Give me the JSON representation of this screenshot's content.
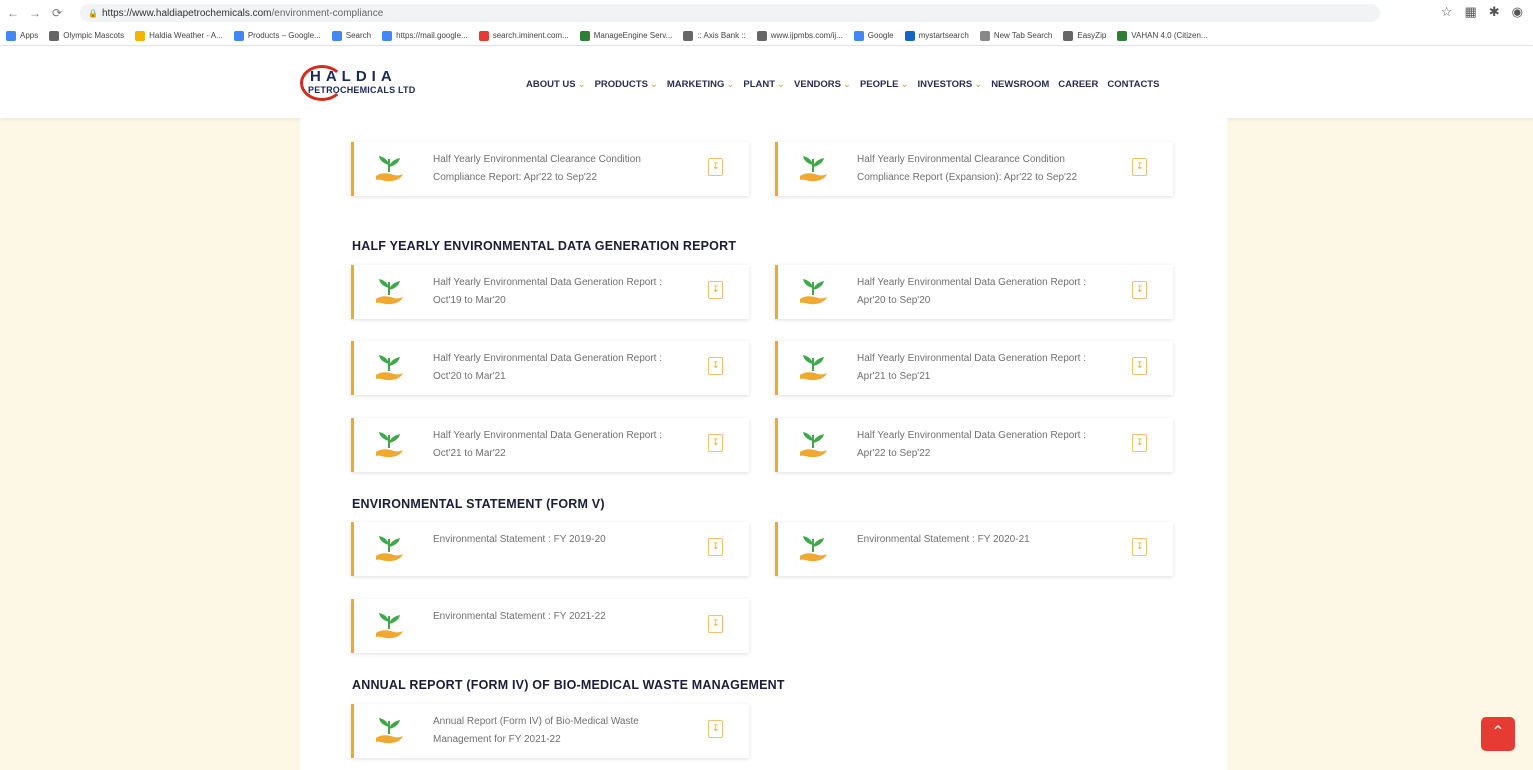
{
  "browser": {
    "url_host": "https://www.haldiapetrochemicals.com",
    "url_path": "/environment-compliance",
    "bookmarks": [
      {
        "label": "Apps",
        "color": "#4285f4"
      },
      {
        "label": "Olympic Mascots",
        "color": "#666666"
      },
      {
        "label": "Haldia Weather - A...",
        "color": "#f4b400"
      },
      {
        "label": "Products – Google...",
        "color": "#4285f4"
      },
      {
        "label": "Search",
        "color": "#4285f4"
      },
      {
        "label": "https://mail.google...",
        "color": "#4285f4"
      },
      {
        "label": "search.iminent.com...",
        "color": "#e53b32"
      },
      {
        "label": "ManageEngine Serv...",
        "color": "#2e7d32"
      },
      {
        "label": ":: Axis Bank ::",
        "color": "#666666"
      },
      {
        "label": "www.ijpmbs.com/ij...",
        "color": "#666666"
      },
      {
        "label": "Google",
        "color": "#4285f4"
      },
      {
        "label": "mystartsearch",
        "color": "#1565c0"
      },
      {
        "label": "New Tab Search",
        "color": "#888888"
      },
      {
        "label": "EasyZip",
        "color": "#666666"
      },
      {
        "label": "VAHAN 4.0 (Citizen...",
        "color": "#2e7d32"
      }
    ]
  },
  "logo": {
    "line1": "HALDIA",
    "line2": "PETROCHEMICALS LTD"
  },
  "nav": [
    {
      "label": "ABOUT US",
      "caret": "⌄"
    },
    {
      "label": "PRODUCTS",
      "caret": "⌄"
    },
    {
      "label": "MARKETING",
      "caret": "⌄"
    },
    {
      "label": "PLANT",
      "caret": "⌄"
    },
    {
      "label": "VENDORS",
      "caret": "⌄"
    },
    {
      "label": "PEOPLE",
      "caret": "⌄"
    },
    {
      "label": "INVESTORS",
      "caret": "⌄"
    },
    {
      "label": "NEWSROOM",
      "caret": ""
    },
    {
      "label": "CAREER",
      "caret": ""
    },
    {
      "label": "CONTACTS",
      "caret": ""
    }
  ],
  "sections": {
    "data_generation": "HALF YEARLY ENVIRONMENTAL DATA GENERATION REPORT",
    "statement": "ENVIRONMENTAL STATEMENT (FORM V)",
    "biomedical": "ANNUAL REPORT (FORM IV) OF BIO-MEDICAL WASTE MANAGEMENT"
  },
  "cards": {
    "clearance_1": "Half Yearly Environmental Clearance Condition Compliance Report: Apr'22 to Sep'22",
    "clearance_2": "Half Yearly Environmental Clearance Condition Compliance Report (Expansion): Apr'22 to Sep'22",
    "datagen_1": "Half Yearly Environmental Data Generation Report : Oct'19 to Mar'20",
    "datagen_2": "Half Yearly Environmental Data Generation Report : Apr'20 to Sep'20",
    "datagen_3": "Half Yearly Environmental Data Generation Report : Oct'20 to Mar'21",
    "datagen_4": "Half Yearly Environmental Data Generation Report : Apr'21 to Sep'21",
    "datagen_5": "Half Yearly Environmental Data Generation Report : Oct'21 to Mar'22",
    "datagen_6": "Half Yearly Environmental Data Generation Report : Apr'22 to Sep'22",
    "statement_1": "Environmental Statement : FY 2019-20",
    "statement_2": "Environmental Statement : FY 2020-21",
    "statement_3": "Environmental Statement : FY 2021-22",
    "biomedical_1": "Annual Report (Form IV) of Bio-Medical Waste Management for FY 2021-22"
  },
  "icons": {
    "card_icon": "plant-hand-icon",
    "download_icon": "pdf-download-icon",
    "scroll_top": "chevron-up-icon"
  },
  "colors": {
    "accent": "#f0a830",
    "plant_green": "#3fa84a",
    "hand": "#f0a830",
    "brand_red": "#d52b1e",
    "navy": "#1a2a55"
  }
}
